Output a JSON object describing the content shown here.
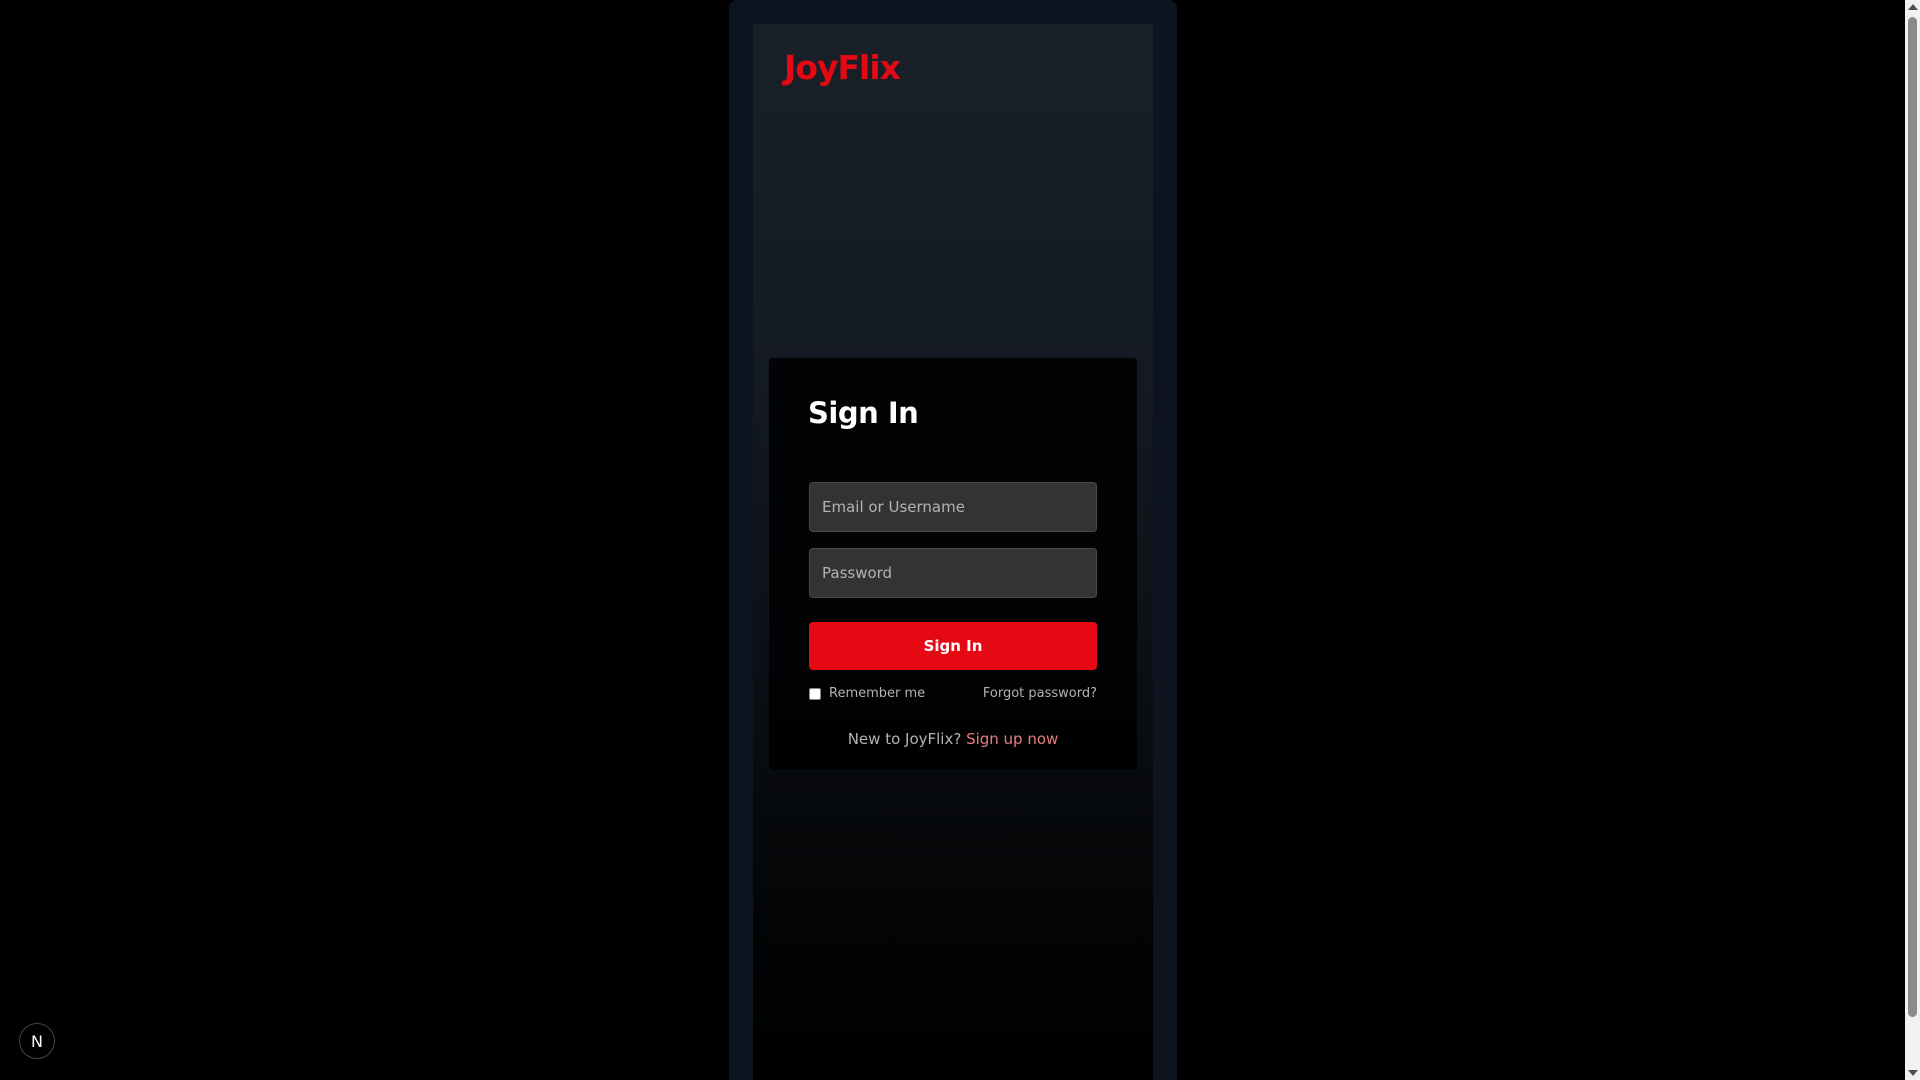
{
  "brand": {
    "logo_text": "JoyFlix",
    "accent_color": "#e50914"
  },
  "signin_card": {
    "title": "Sign In",
    "email_placeholder": "Email or Username",
    "email_value": "",
    "password_placeholder": "Password",
    "password_value": "",
    "submit_label": "Sign In",
    "remember_label": "Remember me",
    "remember_checked": false,
    "forgot_label": "Forgot password?",
    "signup_prompt": "New to JoyFlix?",
    "signup_link": "Sign up now"
  },
  "dev_badge": {
    "label": "N",
    "icon": "nextjs-dev-indicator-icon"
  },
  "scrollbar": {
    "up_icon": "scroll-up-arrow-icon",
    "down_icon": "scroll-down-arrow-icon"
  }
}
